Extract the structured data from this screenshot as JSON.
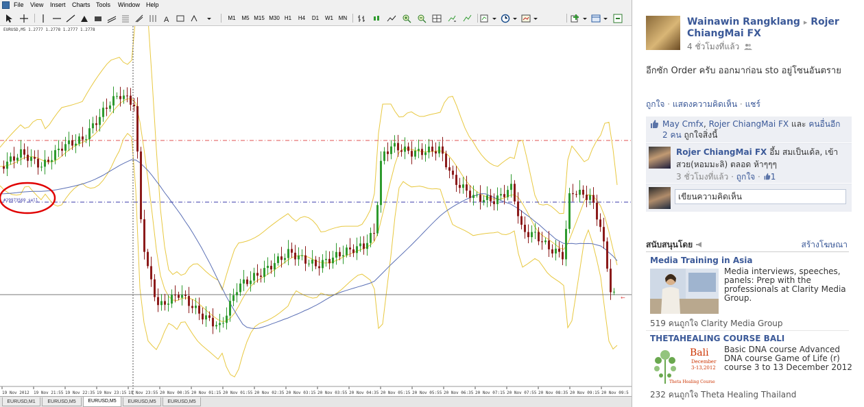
{
  "mt": {
    "menu": [
      "File",
      "View",
      "Insert",
      "Charts",
      "Tools",
      "Window",
      "Help"
    ],
    "timeframes": [
      "M1",
      "M5",
      "M15",
      "M30",
      "H1",
      "H4",
      "D1",
      "W1",
      "MN"
    ],
    "chart_title": "EURUSD,M5  1.2777 1.2778 1.2777 1.2778",
    "order_label": "#29973569 sell",
    "time_labels": [
      "19 Nov 2012",
      "19 Nov 21:55",
      "19 Nov 22:35",
      "19 Nov 23:15",
      "19 Nov 23:55",
      "20 Nov 00:35",
      "20 Nov 01:15",
      "20 Nov 01:55",
      "20 Nov 02:35",
      "20 Nov 03:15",
      "20 Nov 03:55",
      "20 Nov 04:35",
      "20 Nov 05:15",
      "20 Nov 05:55",
      "20 Nov 06:35",
      "20 Nov 07:15",
      "20 Nov 07:55",
      "20 Nov 08:35",
      "20 Nov 09:15",
      "20 Nov 09:5"
    ],
    "tabs": [
      "EURUSD,M1",
      "EURUSD,M5",
      "EURUSD,M5",
      "EURUSD,M5",
      "EURUSD,M5"
    ],
    "active_tab": 2,
    "colors": {
      "bull": "#2e9a2e",
      "bear": "#8b1a1a",
      "bands": "#e8c840",
      "ma": "#5a6fb5",
      "line_red": "#e05050",
      "line_blue": "#3a3aa8"
    }
  },
  "fb": {
    "author": "Wainawin Rangklang",
    "arrow": "▸",
    "target": "Rojer ChiangMai FX",
    "time": "4 ชั่วโมงที่แล้ว",
    "post_text": "อีกซัก Order ครับ ออกมาก่อน sto อยู่โซนอันตราย",
    "actions": {
      "like": "ถูกใจ",
      "comment": "แสดงความคิดเห็น",
      "share": "แชร์",
      "dot": "·"
    },
    "likes": {
      "name1": "May Cmfx",
      "comma": ", ",
      "name2": "Rojer ChiangMai FX",
      "and": " และ ",
      "others": "คนอื่นอีก 2 คน",
      "suffix": " ถูกใจสิ่งนี้"
    },
    "comment": {
      "author": "Rojer ChiangMai FX",
      "text": " อึ้ม สมเป็นเด้ล, เข้าสวย(หอมมะลิ) ตลอด ห้าๆๆๆ",
      "time": "3 ชั่วโมงที่แล้ว",
      "like": "ถูกใจ",
      "like_count": "1"
    },
    "write_placeholder": "เขียนความคิดเห็น",
    "sponsored": "สนับสนุนโดย",
    "create_ad": "สร้างโฆษณา",
    "ads": [
      {
        "title": "Media Training in Asia",
        "text": "Media interviews, speeches, panels: Prep with the professionals at Clarity Media Group.",
        "likes": "519 คนถูกใจ Clarity Media Group"
      },
      {
        "title": "THETAHEALING COURSE BALI",
        "text": "Basic DNA course Advanced DNA course Game of Life (r) course 3 to 13 December 2012",
        "likes": "232 คนถูกใจ Theta Healing Thailand",
        "logo_word": "Bali",
        "logo_month": "December",
        "logo_dates": "3-13,2012",
        "logo_caption": "Theta Healing Course"
      }
    ]
  }
}
